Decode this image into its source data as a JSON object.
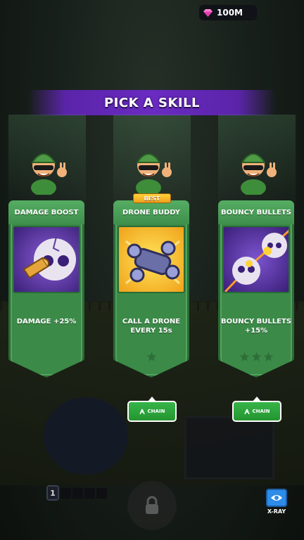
{
  "currency": {
    "gems": "100M",
    "icon": "gem-icon",
    "color": "#e23fb0"
  },
  "header": {
    "title": "PICK A SKILL"
  },
  "skills": [
    {
      "name": "DAMAGE BOOST",
      "description": "DAMAGE +25%",
      "stars_filled": 0,
      "stars_total": 0,
      "best": false,
      "chain": false,
      "icon": "bullet-skull-icon"
    },
    {
      "name": "DRONE BUDDY",
      "description": "CALL A DRONE EVERY 15s",
      "stars_filled": 0,
      "stars_total": 1,
      "best": true,
      "badge": "BEST",
      "chain": true,
      "chain_label": "CHAIN",
      "icon": "drone-icon"
    },
    {
      "name": "BOUNCY BULLETS",
      "description": "BOUNCY BULLETS +15%",
      "stars_filled": 0,
      "stars_total": 3,
      "best": false,
      "chain": true,
      "chain_label": "CHAIN",
      "icon": "ricochet-skulls-icon"
    }
  ],
  "bottom": {
    "level": "1",
    "xray_label": "X-RAY"
  },
  "colors": {
    "banner": "#6a2bc2",
    "card": "#3b8a48",
    "chain": "#2fa53f",
    "xray": "#2d8ce8"
  }
}
